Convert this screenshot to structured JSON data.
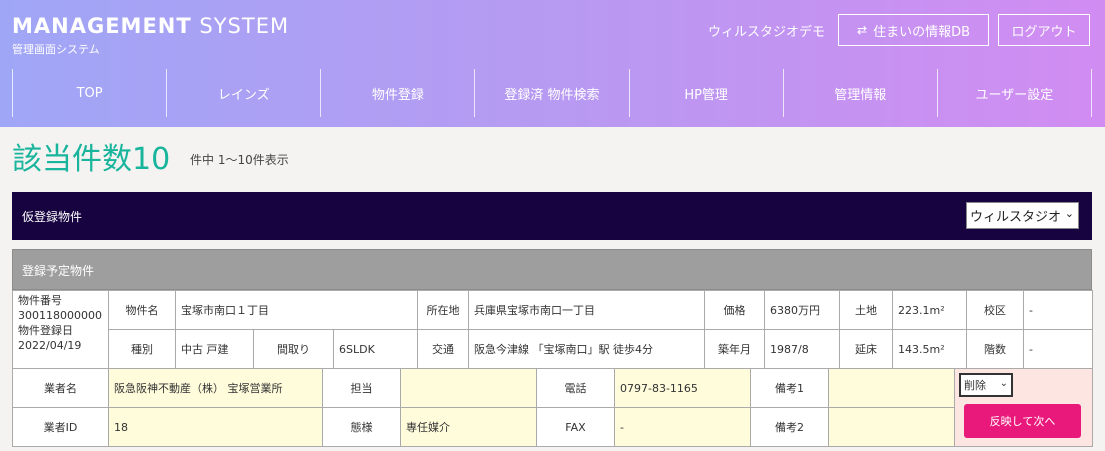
{
  "header": {
    "title_bold": "MANAGEMENT",
    "title_light": "SYSTEM",
    "subtitle": "管理画面システム",
    "company": "ウィルスタジオデモ",
    "db_button": "住まいの情報DB",
    "db_icon": "swap-arrows-icon",
    "logout_button": "ログアウト"
  },
  "nav": [
    "TOP",
    "レインズ",
    "物件登録",
    "登録済 物件検索",
    "HP管理",
    "管理情報",
    "ユーザー設定"
  ],
  "summary": {
    "count_label": "該当件数10",
    "range_label": "件中 1～10件表示"
  },
  "section": {
    "title": "仮登録物件",
    "selected_agency": "ウィルスタジオ"
  },
  "subsection": {
    "title": "登録予定物件"
  },
  "property": {
    "number_label": "物件番号",
    "number": "300118000000",
    "registered_label": "物件登録日",
    "registered": "2022/04/19",
    "name_label": "物件名",
    "name": "宝塚市南口１丁目",
    "location_label": "所在地",
    "location": "兵庫県宝塚市南口一丁目",
    "price_label": "価格",
    "price": "6380万円",
    "land_label": "土地",
    "land": "223.1m²",
    "school_label": "校区",
    "school": "-",
    "type_label": "種別",
    "type": "中古 戸建",
    "layout_label": "間取り",
    "layout": "6SLDK",
    "transit_label": "交通",
    "transit": "阪急今津線 「宝塚南口」駅 徒歩4分",
    "built_label": "築年月",
    "built": "1987/8",
    "floor_label": "延床",
    "floor": "143.5m²",
    "floors_label": "階数",
    "floors": "-"
  },
  "agent": {
    "name_label": "業者名",
    "name": "阪急阪神不動産（株） 宝塚営業所",
    "staff_label": "担当",
    "staff": "",
    "tel_label": "電話",
    "tel": "0797-83-1165",
    "note1_label": "備考1",
    "note1": "",
    "id_label": "業者ID",
    "id": "18",
    "mode_label": "態様",
    "mode": "専任媒介",
    "fax_label": "FAX",
    "fax": "-",
    "note2_label": "備考2",
    "note2": "",
    "action_select": "削除",
    "action_button": "反映して次へ"
  }
}
